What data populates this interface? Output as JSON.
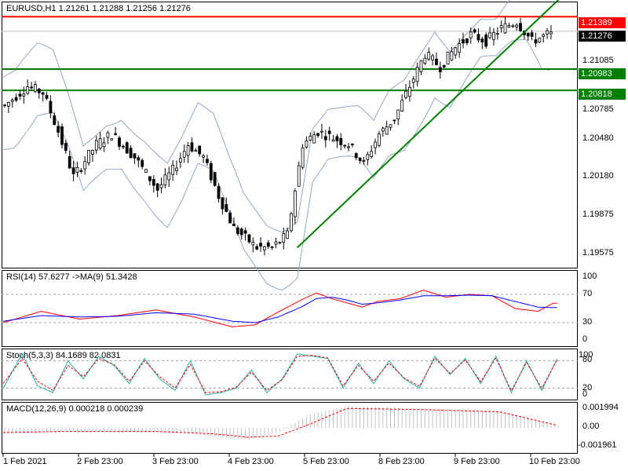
{
  "main": {
    "title": "EURUSD,H1  1.21261  1.21288  1.21256  1.21276",
    "price_axis": [
      "1.21085",
      "1.20785",
      "1.20480",
      "1.20180",
      "1.19875",
      "1.19575"
    ],
    "tags": [
      {
        "label": "1.21389",
        "bg": "#ff0000",
        "fg": "#ffffff"
      },
      {
        "label": "1.21276",
        "bg": "#000000",
        "fg": "#ffffff"
      },
      {
        "label": "1.20983",
        "bg": "#008000",
        "fg": "#ffffff"
      },
      {
        "label": "1.20818",
        "bg": "#008000",
        "fg": "#ffffff"
      }
    ]
  },
  "rsi": {
    "title": "RSI(14) 57.6277  ->MA(9) 51.3428",
    "axis": [
      "100",
      "70",
      "30",
      "0"
    ]
  },
  "stoch": {
    "title": "Stoch(5,3,3) 84.1689 82.0831",
    "axis": [
      "100",
      "80",
      "20",
      "0"
    ]
  },
  "macd": {
    "title": "MACD(12,26,9) 0.000218 0.000239",
    "axis": [
      "0.001994",
      "0.00",
      "-0.001961"
    ]
  },
  "time_axis": [
    "1 Feb 2021",
    "2 Feb 23:00",
    "3 Feb 23:00",
    "4 Feb 23:00",
    "5 Feb 23:00",
    "8 Feb 23:00",
    "9 Feb 23:00",
    "10 Feb 23:00"
  ],
  "colors": {
    "bull": "#ffffff",
    "bear": "#000000",
    "resistance": "#ff0000",
    "support": "#008000",
    "trendline": "#008000",
    "bands": "#8fa7c8",
    "rsi": "#ff0000",
    "rsi_ma": "#0000ff",
    "stoch_main": "#20b2aa",
    "stoch_signal": "#ff0000",
    "macd_hist": "#c0c0c0",
    "macd_signal": "#ff0000"
  },
  "chart_data": [
    {
      "type": "candlestick",
      "symbol": "EURUSD",
      "timeframe": "H1",
      "ylim": [
        1.1945,
        1.215
      ],
      "horizontal_levels": [
        1.21389,
        1.20983,
        1.20818
      ],
      "current_price": 1.21276,
      "trendline": {
        "from": [
          1,
          1.196
        ],
        "to": [
          150,
          1.2165
        ]
      },
      "close_path": [
        [
          0,
          1.207
        ],
        [
          6,
          1.2085
        ],
        [
          10,
          1.208
        ],
        [
          14,
          1.205
        ],
        [
          18,
          1.2015
        ],
        [
          24,
          1.204
        ],
        [
          28,
          1.2048
        ],
        [
          34,
          1.203
        ],
        [
          40,
          1.2005
        ],
        [
          44,
          1.202
        ],
        [
          48,
          1.204
        ],
        [
          52,
          1.203
        ],
        [
          56,
          1.2
        ],
        [
          60,
          1.1975
        ],
        [
          66,
          1.196
        ],
        [
          70,
          1.196
        ],
        [
          74,
          1.197
        ],
        [
          78,
          1.204
        ],
        [
          82,
          1.205
        ],
        [
          86,
          1.2045
        ],
        [
          90,
          1.204
        ],
        [
          94,
          1.2025
        ],
        [
          98,
          1.2048
        ],
        [
          102,
          1.206
        ],
        [
          106,
          1.2085
        ],
        [
          110,
          1.211
        ],
        [
          114,
          1.21
        ],
        [
          118,
          1.2115
        ],
        [
          122,
          1.2125
        ],
        [
          126,
          1.212
        ],
        [
          130,
          1.213
        ],
        [
          134,
          1.2135
        ],
        [
          138,
          1.212
        ],
        [
          142,
          1.2125
        ]
      ]
    },
    {
      "type": "line",
      "name": "RSI(14)",
      "ylim": [
        0,
        100
      ],
      "levels": [
        70,
        30
      ],
      "series": [
        {
          "name": "RSI",
          "x": [
            0,
            10,
            20,
            30,
            40,
            50,
            60,
            66,
            72,
            78,
            82,
            86,
            90,
            94,
            98,
            104,
            110,
            116,
            122,
            128,
            134,
            140,
            144
          ],
          "values": [
            30,
            46,
            35,
            40,
            48,
            38,
            24,
            27,
            45,
            62,
            72,
            64,
            58,
            52,
            60,
            64,
            76,
            66,
            70,
            68,
            50,
            46,
            57.6
          ]
        },
        {
          "name": "MA(9)",
          "x": [
            0,
            10,
            20,
            30,
            40,
            50,
            60,
            66,
            72,
            78,
            82,
            86,
            90,
            94,
            98,
            104,
            110,
            116,
            122,
            128,
            134,
            140,
            144
          ],
          "values": [
            32,
            40,
            38,
            39,
            44,
            42,
            32,
            30,
            38,
            52,
            64,
            66,
            62,
            56,
            58,
            62,
            68,
            68,
            69,
            68,
            60,
            52,
            51.3
          ]
        }
      ]
    },
    {
      "type": "line",
      "name": "Stoch(5,3,3)",
      "ylim": [
        0,
        100
      ],
      "levels": [
        80,
        20
      ],
      "series": [
        {
          "name": "Main",
          "x": [
            0,
            5,
            9,
            13,
            17,
            21,
            25,
            29,
            33,
            37,
            41,
            45,
            49,
            53,
            57,
            61,
            65,
            69,
            73,
            77,
            81,
            85,
            89,
            93,
            97,
            101,
            105,
            109,
            113,
            117,
            121,
            125,
            129,
            133,
            137,
            141,
            145
          ],
          "values": [
            20,
            95,
            25,
            10,
            80,
            40,
            90,
            70,
            30,
            85,
            40,
            15,
            80,
            5,
            10,
            20,
            60,
            10,
            40,
            95,
            90,
            85,
            20,
            75,
            30,
            80,
            40,
            20,
            90,
            50,
            85,
            30,
            90,
            10,
            80,
            15,
            84.2
          ]
        },
        {
          "name": "Signal",
          "x": [
            0,
            5,
            9,
            13,
            17,
            21,
            25,
            29,
            33,
            37,
            41,
            45,
            49,
            53,
            57,
            61,
            65,
            69,
            73,
            77,
            81,
            85,
            89,
            93,
            97,
            101,
            105,
            109,
            113,
            117,
            121,
            125,
            129,
            133,
            137,
            141,
            145
          ],
          "values": [
            30,
            85,
            35,
            15,
            70,
            45,
            85,
            72,
            35,
            80,
            45,
            20,
            72,
            10,
            12,
            22,
            55,
            15,
            38,
            90,
            92,
            86,
            25,
            70,
            35,
            75,
            42,
            24,
            86,
            52,
            82,
            34,
            86,
            14,
            76,
            20,
            82.1
          ]
        }
      ]
    },
    {
      "type": "bar",
      "name": "MACD(12,26,9)",
      "ylim": [
        -0.001961,
        0.001994
      ],
      "histogram": {
        "x": [
          0,
          15,
          30,
          40,
          55,
          64,
          72,
          80,
          90,
          110,
          130,
          145
        ],
        "values": [
          -0.0005,
          -0.0002,
          -0.0004,
          -0.0002,
          -0.0007,
          -0.001,
          -0.0003,
          0.0012,
          0.0019,
          0.0017,
          0.0015,
          0.0002
        ]
      },
      "series": [
        {
          "name": "Signal",
          "x": [
            0,
            15,
            30,
            40,
            55,
            64,
            72,
            80,
            90,
            110,
            130,
            145
          ],
          "values": [
            -0.0004,
            -0.0003,
            -0.0003,
            -0.0003,
            -0.0005,
            -0.0008,
            -0.0007,
            0.0003,
            0.0017,
            0.0016,
            0.0014,
            0.00024
          ]
        }
      ]
    }
  ]
}
